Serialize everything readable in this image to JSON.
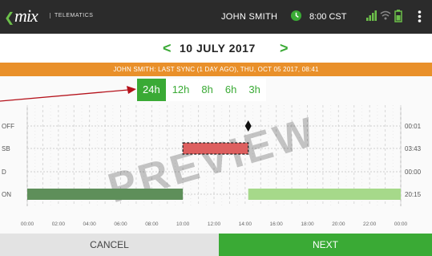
{
  "topbar": {
    "logo_text": "mix",
    "logo_subtitle": "TELEMATICS",
    "user_name": "JOHN SMITH",
    "time": "8:00 CST",
    "icons": [
      "back-icon",
      "clock-icon",
      "signal-icon",
      "wifi-icon",
      "battery-icon",
      "more-icon"
    ],
    "accent_color": "#6cc04a"
  },
  "datebar": {
    "prev_glyph": "<",
    "next_glyph": ">",
    "date": "10 JULY 2017"
  },
  "sync": {
    "text": "JOHN SMITH: LAST SYNC (1 DAY AGO), THU, OCT 05 2017, 08:41",
    "color": "#e9902a"
  },
  "tabs": [
    {
      "label": "24h",
      "active": true
    },
    {
      "label": "12h",
      "active": false
    },
    {
      "label": "8h",
      "active": false
    },
    {
      "label": "6h",
      "active": false
    },
    {
      "label": "3h",
      "active": false
    }
  ],
  "chart_data": {
    "type": "timeline",
    "rows": [
      "OFF",
      "SB",
      "D",
      "ON"
    ],
    "row_totals": [
      "00:01",
      "03:43",
      "00:00",
      "20:15"
    ],
    "x_ticks": [
      "00:00",
      "02:00",
      "04:00",
      "06:00",
      "08:00",
      "10:00",
      "12:00",
      "14:00",
      "16:00",
      "18:00",
      "20:00",
      "22:00",
      "00:00"
    ],
    "x_range_hours": [
      0,
      24
    ],
    "watermark": "PREVIEW",
    "segments": [
      {
        "row": "ON",
        "start": 0,
        "end": 10.0,
        "color": "#5e8f5a"
      },
      {
        "row": "SB",
        "start": 10.0,
        "end": 14.2,
        "color": "#dd5f5f",
        "selected": true
      },
      {
        "row": "ON",
        "start": 14.2,
        "end": 24,
        "color": "#a6d98a"
      }
    ],
    "markers": [
      {
        "row": "OFF",
        "at": 14.2,
        "shape": "diamond"
      }
    ],
    "grid": true
  },
  "footer": {
    "cancel_label": "CANCEL",
    "next_label": "NEXT"
  }
}
